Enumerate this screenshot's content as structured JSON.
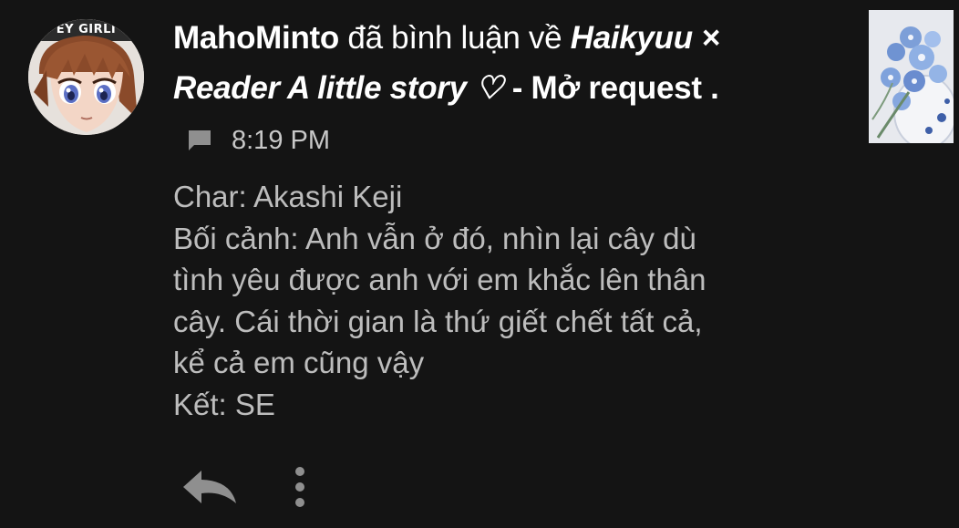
{
  "notification": {
    "avatar": {
      "overlay_text": "EY GIRLI",
      "icon": "anime-avatar"
    },
    "user": "MahoMinto",
    "verb": "đã bình luận về",
    "story_title": "Haikyuu × Reader A little story ♡",
    "suffix": "- Mở request .",
    "time": "8:19 PM",
    "comment_icon": "comment-icon",
    "body_lines": [
      "Char: Akashi Keji",
      "Bối cảnh:  Anh vẫn ở đó, nhìn lại cây dù",
      "tình yêu được anh với em khắc lên thân",
      "cây. Cái thời gian là thứ giết chết tất cả,",
      "kể cả em cũng vậy",
      "Kết: SE"
    ],
    "thumbnail": "blue-flowers-thumbnail"
  },
  "actions": {
    "reply_icon": "reply-icon",
    "more_icon": "more-vertical-icon"
  },
  "colors": {
    "background": "#141414",
    "headline": "#ffffff",
    "body": "#bdbdbd",
    "meta": "#c8c8c8",
    "icon": "#8f8f8f"
  }
}
